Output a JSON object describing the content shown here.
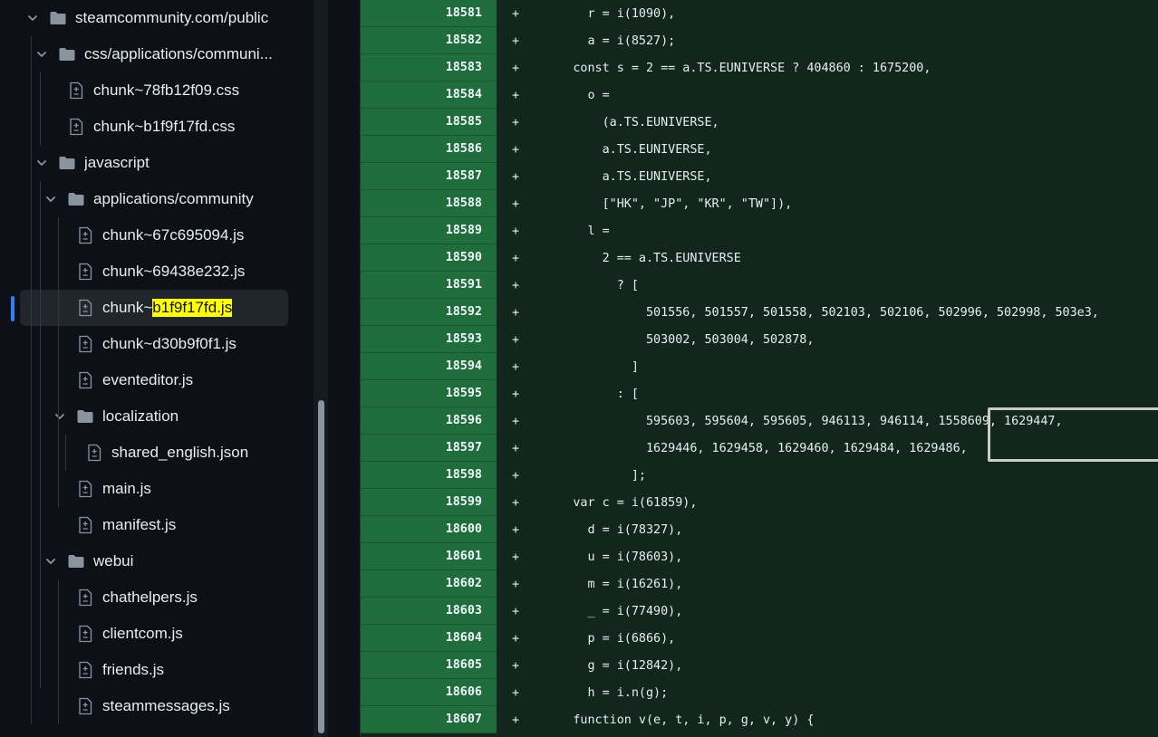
{
  "tree": [
    {
      "type": "folder",
      "depth": 0,
      "label": "steamcommunity.com/public"
    },
    {
      "type": "folder",
      "depth": 1,
      "label": "css/applications/communi..."
    },
    {
      "type": "file",
      "depth": 2,
      "label": "chunk~78fb12f09.css"
    },
    {
      "type": "file",
      "depth": 2,
      "label": "chunk~b1f9f17fd.css"
    },
    {
      "type": "folder",
      "depth": 1,
      "label": "javascript"
    },
    {
      "type": "folder",
      "depth": 2,
      "label": "applications/community"
    },
    {
      "type": "file",
      "depth": 3,
      "label": "chunk~67c695094.js"
    },
    {
      "type": "file",
      "depth": 3,
      "label": "chunk~69438e232.js"
    },
    {
      "type": "file",
      "depth": 3,
      "label": "chunk~",
      "highlight": "b1f9f17fd.js",
      "selected": true
    },
    {
      "type": "file",
      "depth": 3,
      "label": "chunk~d30b9f0f1.js"
    },
    {
      "type": "file",
      "depth": 3,
      "label": "eventeditor.js"
    },
    {
      "type": "folder",
      "depth": 3,
      "label": "localization"
    },
    {
      "type": "file",
      "depth": 4,
      "label": "shared_english.json"
    },
    {
      "type": "file",
      "depth": 3,
      "label": "main.js"
    },
    {
      "type": "file",
      "depth": 3,
      "label": "manifest.js"
    },
    {
      "type": "folder",
      "depth": 2,
      "label": "webui"
    },
    {
      "type": "file",
      "depth": 3,
      "label": "chathelpers.js"
    },
    {
      "type": "file",
      "depth": 3,
      "label": "clientcom.js"
    },
    {
      "type": "file",
      "depth": 3,
      "label": "friends.js"
    },
    {
      "type": "file",
      "depth": 3,
      "label": "steammessages.js"
    }
  ],
  "diff": {
    "sign": "+",
    "lines": [
      {
        "num": "18581",
        "code": "        r = i(1090),"
      },
      {
        "num": "18582",
        "code": "        a = i(8527);"
      },
      {
        "num": "18583",
        "code": "      const s = 2 == a.TS.EUNIVERSE ? 404860 : 1675200,"
      },
      {
        "num": "18584",
        "code": "        o ="
      },
      {
        "num": "18585",
        "code": "          (a.TS.EUNIVERSE,"
      },
      {
        "num": "18586",
        "code": "          a.TS.EUNIVERSE,"
      },
      {
        "num": "18587",
        "code": "          a.TS.EUNIVERSE,"
      },
      {
        "num": "18588",
        "code": "          [\"HK\", \"JP\", \"KR\", \"TW\"]),"
      },
      {
        "num": "18589",
        "code": "        l ="
      },
      {
        "num": "18590",
        "code": "          2 == a.TS.EUNIVERSE"
      },
      {
        "num": "18591",
        "code": "            ? ["
      },
      {
        "num": "18592",
        "code": "                501556, 501557, 501558, 502103, 502106, 502996, 502998, 503e3,"
      },
      {
        "num": "18593",
        "code": "                503002, 503004, 502878,"
      },
      {
        "num": "18594",
        "code": "              ]"
      },
      {
        "num": "18595",
        "code": "            : ["
      },
      {
        "num": "18596",
        "code": "                595603, 595604, 595605, 946113, 946114, 1558609, 1629447,"
      },
      {
        "num": "18597",
        "code": "                1629446, 1629458, 1629460, 1629484, 1629486,"
      },
      {
        "num": "18598",
        "code": "              ];"
      },
      {
        "num": "18599",
        "code": "      var c = i(61859),"
      },
      {
        "num": "18600",
        "code": "        d = i(78327),"
      },
      {
        "num": "18601",
        "code": "        u = i(78603),"
      },
      {
        "num": "18602",
        "code": "        m = i(16261),"
      },
      {
        "num": "18603",
        "code": "        _ = i(77490),"
      },
      {
        "num": "18604",
        "code": "        p = i(6866),"
      },
      {
        "num": "18605",
        "code": "        g = i(12842),"
      },
      {
        "num": "18606",
        "code": "        h = i.n(g);"
      },
      {
        "num": "18607",
        "code": "      function v(e, t, i, p, g, v, y) {"
      }
    ]
  },
  "icons": {
    "folder": "folder-icon",
    "file": "file-diff-icon",
    "chevron": "chevron-down-icon"
  },
  "colors": {
    "added_gutter": "#1f6d3b",
    "added_line": "#12261e",
    "selected_marker": "#2f81f7",
    "search_highlight": "#ffff00"
  }
}
